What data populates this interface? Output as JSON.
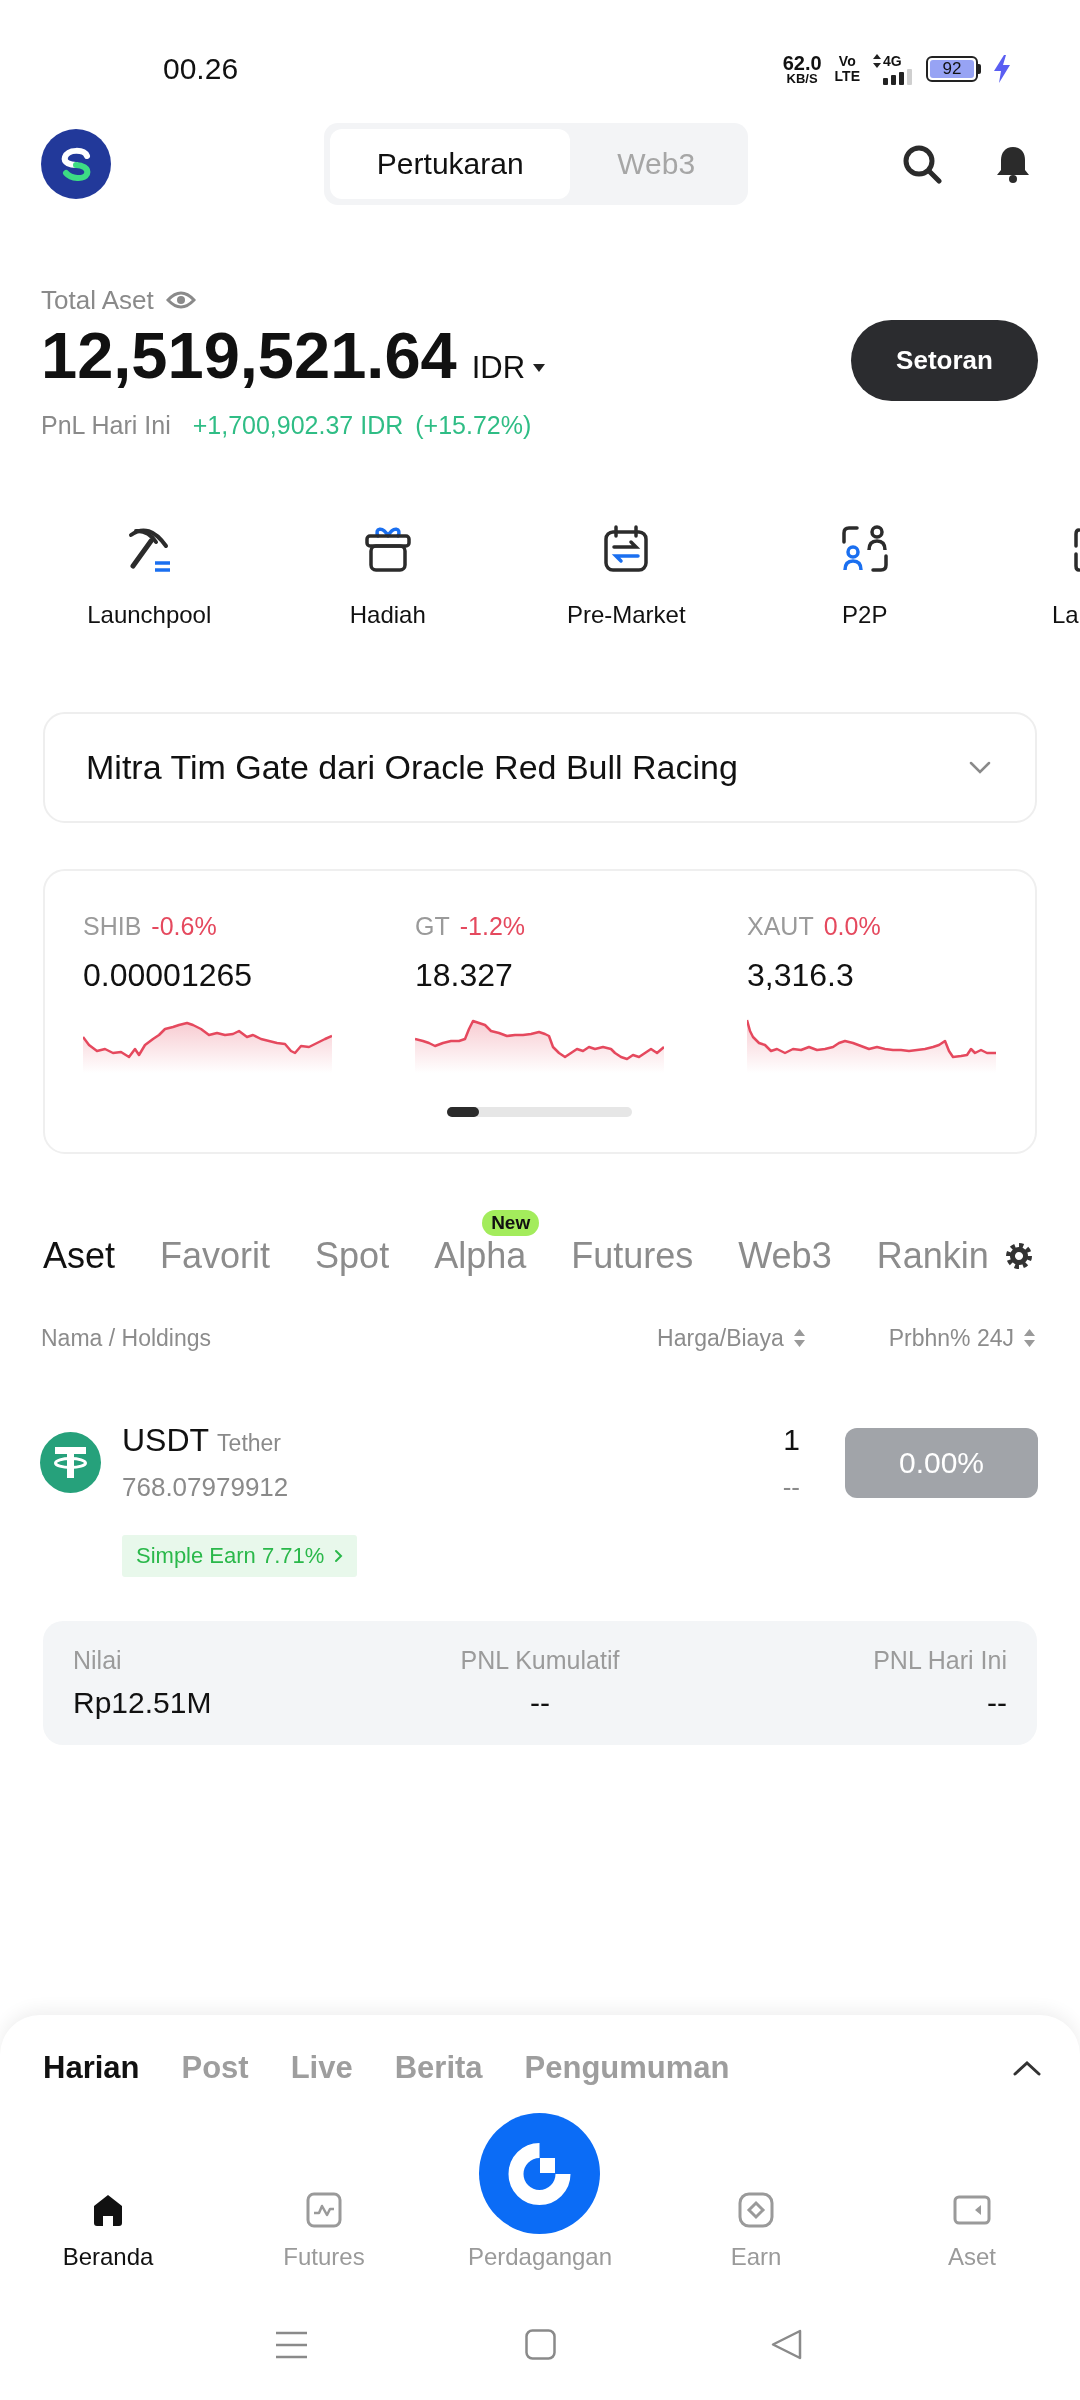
{
  "status_bar": {
    "time": "00.26",
    "net_speed": "62.0",
    "net_unit": "KB/S",
    "volte_top": "Vo",
    "volte_bottom": "LTE",
    "network": "4G",
    "battery": "92",
    "charging": true
  },
  "header": {
    "segments": [
      {
        "label": "Pertukaran",
        "selected": true
      },
      {
        "label": "Web3",
        "selected": false
      }
    ]
  },
  "balance": {
    "label": "Total Aset",
    "amount": "12,519,521.64",
    "currency": "IDR",
    "pnl_label": "PnL Hari Ini",
    "pnl_value": "+1,700,902.37 IDR",
    "pnl_percent": "(+15.72%)",
    "deposit_button": "Setoran"
  },
  "shortcuts": [
    {
      "label": "Launchpool",
      "cut_off": false
    },
    {
      "label": "Hadiah",
      "cut_off": false
    },
    {
      "label": "Pre-Market",
      "cut_off": false
    },
    {
      "label": "P2P",
      "cut_off": false
    },
    {
      "label": "La",
      "cut_off": true
    }
  ],
  "banner": {
    "text": "Mitra Tim Gate dari Oracle Red Bull Racing"
  },
  "tickers": [
    {
      "symbol": "SHIB",
      "change": "-0.6%",
      "price": "0.00001265"
    },
    {
      "symbol": "GT",
      "change": "-1.2%",
      "price": "18.327"
    },
    {
      "symbol": "XAUT",
      "change": "0.0%",
      "price": "3,316.3"
    }
  ],
  "market_tabs": [
    {
      "label": "Aset",
      "selected": true
    },
    {
      "label": "Favorit",
      "selected": false
    },
    {
      "label": "Spot",
      "selected": false
    },
    {
      "label": "Alpha",
      "selected": false,
      "badge": "New"
    },
    {
      "label": "Futures",
      "selected": false
    },
    {
      "label": "Web3",
      "selected": false
    },
    {
      "label": "Rankin",
      "selected": false
    }
  ],
  "columns": {
    "name": "Nama / Holdings",
    "price": "Harga/Biaya",
    "change": "Prbhn% 24J"
  },
  "assets": [
    {
      "symbol": "USDT",
      "name": "Tether",
      "holdings": "768.07979912",
      "price": "1",
      "cost": "--",
      "change": "0.00%",
      "earn_tag": "Simple Earn 7.71%"
    }
  ],
  "summary": [
    {
      "label": "Nilai",
      "value": "Rp12.51M"
    },
    {
      "label": "PNL Kumulatif",
      "value": "--"
    },
    {
      "label": "PNL Hari Ini",
      "value": "--"
    }
  ],
  "feed_tabs": [
    {
      "label": "Harian",
      "selected": true
    },
    {
      "label": "Post",
      "selected": false
    },
    {
      "label": "Live",
      "selected": false
    },
    {
      "label": "Berita",
      "selected": false
    },
    {
      "label": "Pengumuman",
      "selected": false
    }
  ],
  "bottom_nav": [
    {
      "label": "Beranda",
      "kind": "tab",
      "selected": true
    },
    {
      "label": "Futures",
      "kind": "tab",
      "selected": false
    },
    {
      "label": "Perdagangan",
      "kind": "main",
      "selected": false
    },
    {
      "label": "Earn",
      "kind": "tab",
      "selected": false
    },
    {
      "label": "Aset",
      "kind": "tab",
      "selected": false
    }
  ]
}
